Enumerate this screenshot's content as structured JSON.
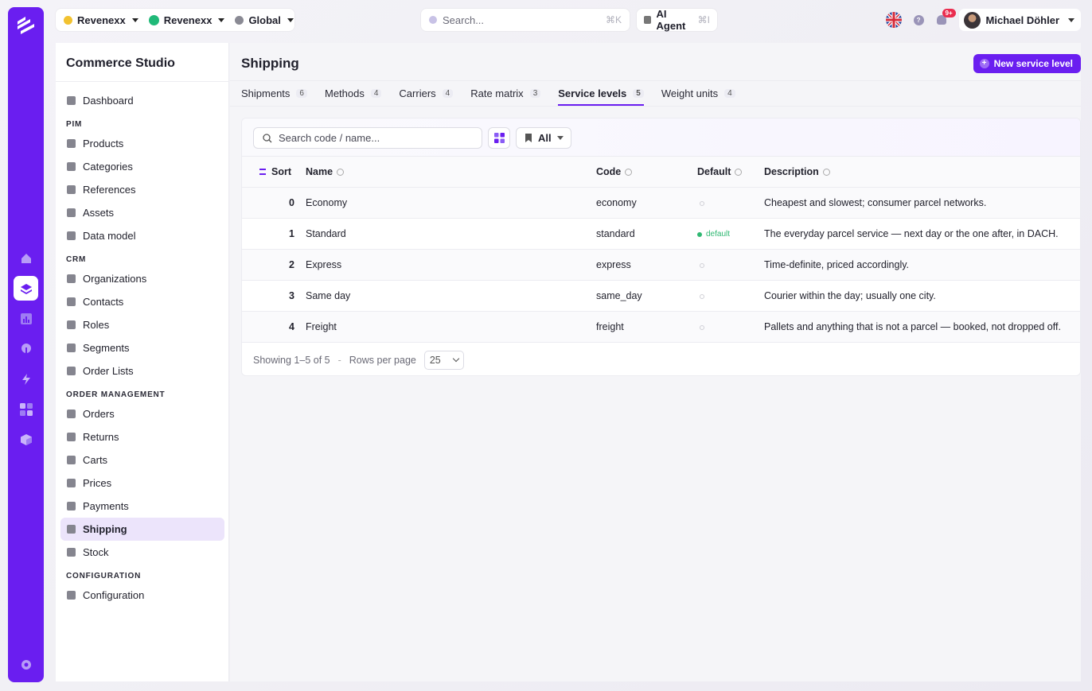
{
  "topbar": {
    "org1": "Revenexx",
    "org2": "Revenexx",
    "region": "Global",
    "search_placeholder": "Search...",
    "search_shortcut": "⌘K",
    "ai_agent_label": "AI Agent",
    "ai_agent_shortcut": "⌘I",
    "notification_count": "9+",
    "user_name": "Michael Döhler"
  },
  "sidebar": {
    "app_title": "Commerce Studio",
    "top_items": [
      {
        "label": "Dashboard"
      }
    ],
    "pim_label": "PIM",
    "pim_items": [
      {
        "label": "Products"
      },
      {
        "label": "Categories"
      },
      {
        "label": "References"
      },
      {
        "label": "Assets"
      },
      {
        "label": "Data model"
      }
    ],
    "crm_label": "CRM",
    "crm_items": [
      {
        "label": "Organizations"
      },
      {
        "label": "Contacts"
      },
      {
        "label": "Roles"
      },
      {
        "label": "Segments"
      },
      {
        "label": "Order Lists"
      }
    ],
    "om_label": "ORDER MANAGEMENT",
    "om_items": [
      {
        "label": "Orders"
      },
      {
        "label": "Returns"
      },
      {
        "label": "Carts"
      },
      {
        "label": "Prices"
      },
      {
        "label": "Payments"
      },
      {
        "label": "Shipping"
      },
      {
        "label": "Stock"
      }
    ],
    "config_label": "CONFIGURATION",
    "config_items": [
      {
        "label": "Configuration"
      }
    ]
  },
  "page": {
    "title": "Shipping",
    "new_button": "New service level",
    "tabs": [
      {
        "label": "Shipments",
        "count": "6"
      },
      {
        "label": "Methods",
        "count": "4"
      },
      {
        "label": "Carriers",
        "count": "4"
      },
      {
        "label": "Rate matrix",
        "count": "3"
      },
      {
        "label": "Service levels",
        "count": "5"
      },
      {
        "label": "Weight units",
        "count": "4"
      }
    ],
    "active_tab": "Service levels"
  },
  "toolbar": {
    "search_placeholder": "Search code / name...",
    "filter_label": "All"
  },
  "table": {
    "headers": {
      "sort": "Sort",
      "name": "Name",
      "code": "Code",
      "default": "Default",
      "description": "Description"
    },
    "rows": [
      {
        "sort": "0",
        "name": "Economy",
        "code": "economy",
        "default": "",
        "description": "Cheapest and slowest; consumer parcel networks."
      },
      {
        "sort": "1",
        "name": "Standard",
        "code": "standard",
        "default": "default",
        "description": "The everyday parcel service — next day or the one after, in DACH."
      },
      {
        "sort": "2",
        "name": "Express",
        "code": "express",
        "default": "",
        "description": "Time-definite, priced accordingly."
      },
      {
        "sort": "3",
        "name": "Same day",
        "code": "same_day",
        "default": "",
        "description": "Courier within the day; usually one city."
      },
      {
        "sort": "4",
        "name": "Freight",
        "code": "freight",
        "default": "",
        "description": "Pallets and anything that is not a parcel — booked, not dropped off."
      }
    ]
  },
  "footer": {
    "showing": "Showing 1–5 of 5",
    "separator": "-",
    "rows_per_page_label": "Rows per page",
    "rows_per_page_value": "25"
  },
  "colors": {
    "accent": "#6a1ef0",
    "success": "#2fb872",
    "badge": "#ea2d4f"
  }
}
